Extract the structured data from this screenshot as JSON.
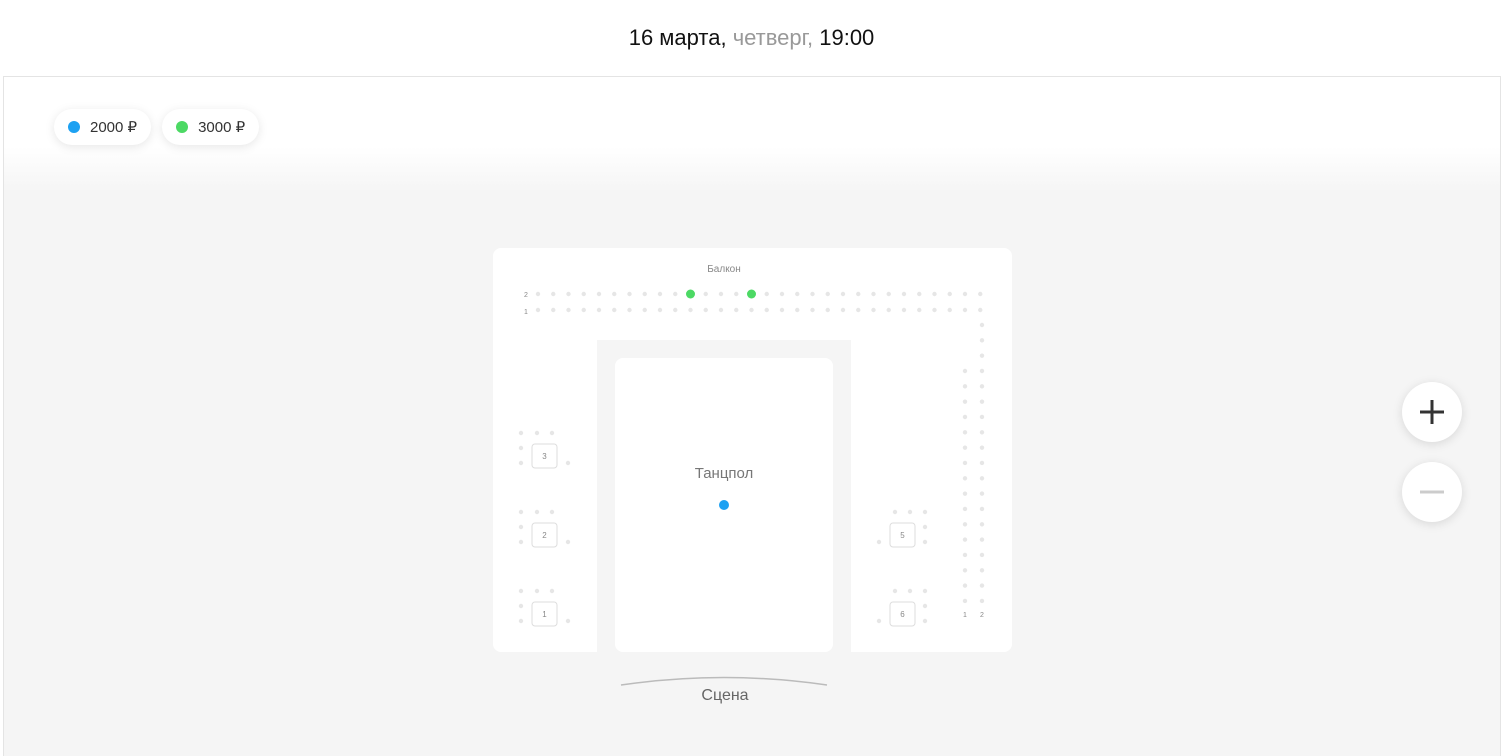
{
  "header": {
    "date": "16 марта,",
    "weekday": "четверг,",
    "time": "19:00"
  },
  "legend": [
    {
      "label": "2000 ₽",
      "color": "#1da1f2"
    },
    {
      "label": "3000 ₽",
      "color": "#4cd964"
    }
  ],
  "hall": {
    "balcony_label": "Балкон",
    "dancefloor_label": "Танцпол",
    "stage_label": "Сцена",
    "balcony_rows": [
      "2",
      "1"
    ],
    "side_rows": [
      "1",
      "2"
    ],
    "tables_left": [
      "3",
      "2",
      "1"
    ],
    "tables_right": [
      "5",
      "6"
    ],
    "available_balcony_seats": [
      {
        "row": "2",
        "seat_index": 10,
        "price": "3000 ₽"
      },
      {
        "row": "2",
        "seat_index": 14,
        "price": "3000 ₽"
      }
    ],
    "dancefloor_price": "2000 ₽"
  },
  "colors": {
    "price_2000": "#1da1f2",
    "price_3000": "#4cd964",
    "seat_unavailable": "#e6e6e6"
  },
  "icons": {
    "zoom_in": "plus-icon",
    "zoom_out": "minus-icon"
  }
}
